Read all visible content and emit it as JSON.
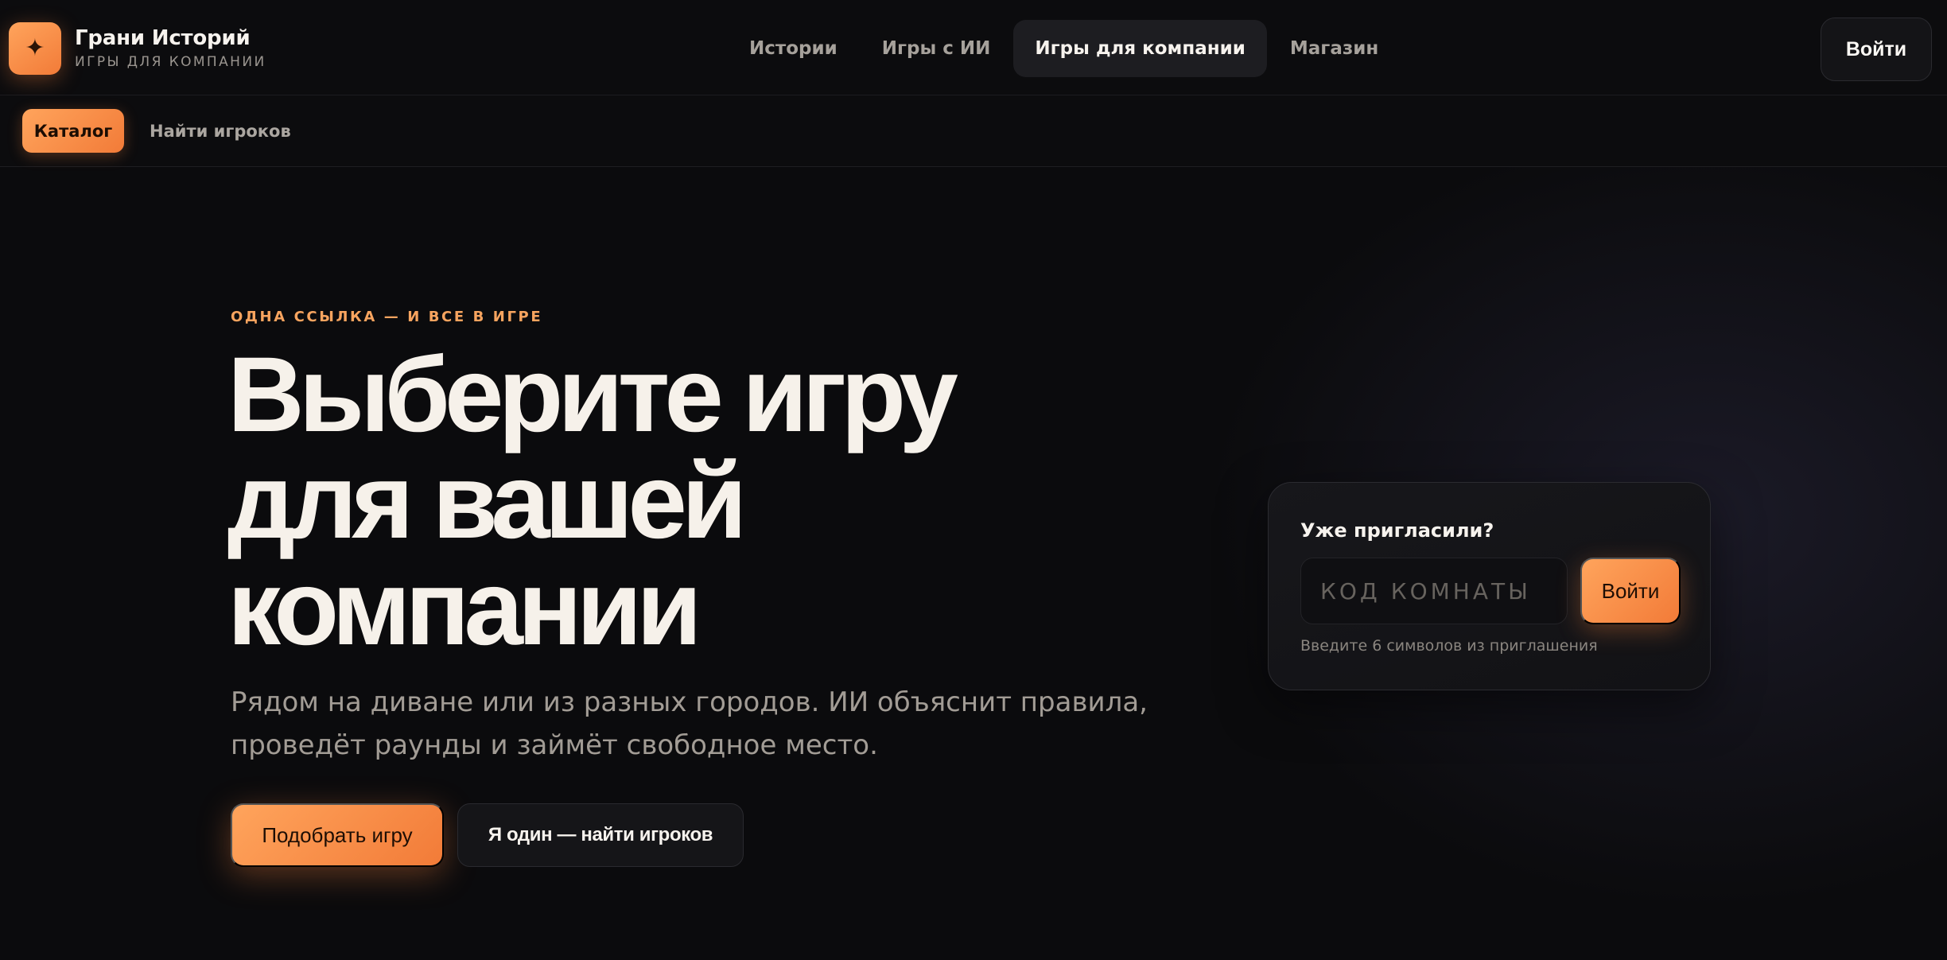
{
  "brand": {
    "icon": "sparkle-icon",
    "name": "Грани Историй",
    "tagline": "ИГРЫ ДЛЯ КОМПАНИИ"
  },
  "nav": {
    "items": [
      {
        "label": "Истории",
        "active": false
      },
      {
        "label": "Игры с ИИ",
        "active": false
      },
      {
        "label": "Игры для компании",
        "active": true
      },
      {
        "label": "Магазин",
        "active": false
      }
    ],
    "login_label": "Войти"
  },
  "subnav": {
    "items": [
      {
        "label": "Каталог",
        "active": true
      },
      {
        "label": "Найти игроков",
        "active": false
      }
    ]
  },
  "hero": {
    "eyebrow": "ОДНА ССЫЛКА — И ВСЕ В ИГРЕ",
    "headline_lines": [
      "Выберите игру",
      "для вашей",
      "компании"
    ],
    "lede_lines": [
      "Рядом на диване или из разных городов. ИИ объяснит правила,",
      "проведёт раунды и займёт свободное место."
    ],
    "primary_cta": "Подобрать игру",
    "secondary_cta": "Я один — найти игроков"
  },
  "join_card": {
    "title": "Уже пригласили?",
    "code_placeholder": "КОД КОМНАТЫ",
    "code_value": "",
    "button_label": "Войти",
    "hint": "Введите 6 символов из приглашения"
  },
  "colors": {
    "accent_from": "#ffa45c",
    "accent_to": "#f27b38",
    "background": "#0b0b0d",
    "eyebrow": "#f7a45f"
  }
}
